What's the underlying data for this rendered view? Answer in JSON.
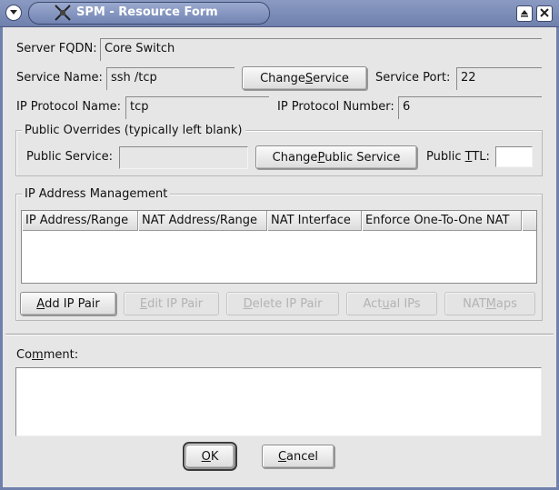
{
  "window": {
    "title": "SPM - Resource Form",
    "icon": "satellite-icon",
    "controls": [
      "menu-down-icon",
      "maximize-icon",
      "close-icon"
    ]
  },
  "server": {
    "label": "Server FQDN:",
    "value": "Core Switch"
  },
  "service": {
    "label": "Service Name:",
    "value": "ssh /tcp",
    "change_button": {
      "pre": "Change ",
      "mnemonic": "S",
      "post": "ervice"
    },
    "port_label": "Service Port:",
    "port_value": "22"
  },
  "protocol": {
    "name_label": "IP Protocol Name:",
    "name_value": "tcp",
    "number_label": "IP Protocol Number:",
    "number_value": "6"
  },
  "public_overrides": {
    "title": "Public Overrides (typically left blank)",
    "service_label": "Public Service:",
    "service_value": "",
    "change_button": {
      "pre": "Change ",
      "mnemonic": "P",
      "post": "ublic Service"
    },
    "ttl_label": {
      "pre": "Public ",
      "mnemonic": "T",
      "post": "TL:"
    },
    "ttl_value": ""
  },
  "ip_management": {
    "title": "IP Address Management",
    "columns": [
      "IP Address/Range",
      "NAT Address/Range",
      "NAT Interface",
      "Enforce One-To-One NAT"
    ],
    "rows": [],
    "buttons": [
      {
        "pre": "",
        "mnemonic": "A",
        "post": "dd IP Pair",
        "enabled": true
      },
      {
        "pre": "",
        "mnemonic": "E",
        "post": "dit IP Pair",
        "enabled": false
      },
      {
        "pre": "",
        "mnemonic": "D",
        "post": "elete IP Pair",
        "enabled": false
      },
      {
        "pre": "Act",
        "mnemonic": "u",
        "post": "al IPs",
        "enabled": false
      },
      {
        "pre": "NAT ",
        "mnemonic": "M",
        "post": "aps",
        "enabled": false
      }
    ]
  },
  "comment": {
    "label": {
      "pre": "Co",
      "mnemonic": "m",
      "post": "ment:"
    },
    "value": ""
  },
  "footer": {
    "ok": {
      "pre": "",
      "mnemonic": "O",
      "post": "K"
    },
    "cancel": {
      "pre": "",
      "mnemonic": "C",
      "post": "ancel"
    }
  },
  "colors": {
    "titlebar": "#7a8bb7",
    "background": "#e6e6e6",
    "disabled_text": "#b3b3b3"
  }
}
